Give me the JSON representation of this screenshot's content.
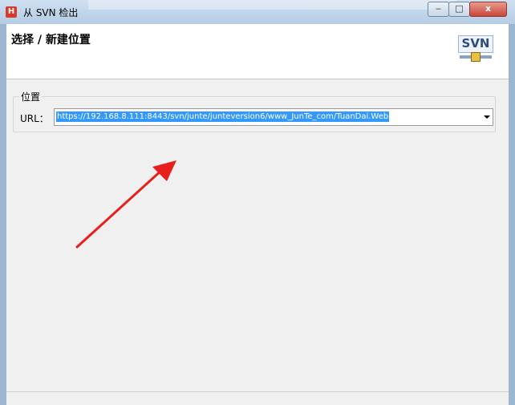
{
  "window": {
    "app_icon_letter": "H",
    "title": "从 SVN 检出",
    "minimize_glyph": "‒",
    "maximize_glyph": "□",
    "close_glyph": "x"
  },
  "page": {
    "title": "选择 / 新建位置",
    "logo_text": "SVN"
  },
  "location": {
    "group_label": "位置",
    "url_label": "URL：",
    "url_value": "https://192.168.8.111:8443/svn/junte/junteversion6/www_JunTe_com/TuanDai.Web"
  },
  "annotation": {
    "arrow_color": "#e8201c"
  }
}
